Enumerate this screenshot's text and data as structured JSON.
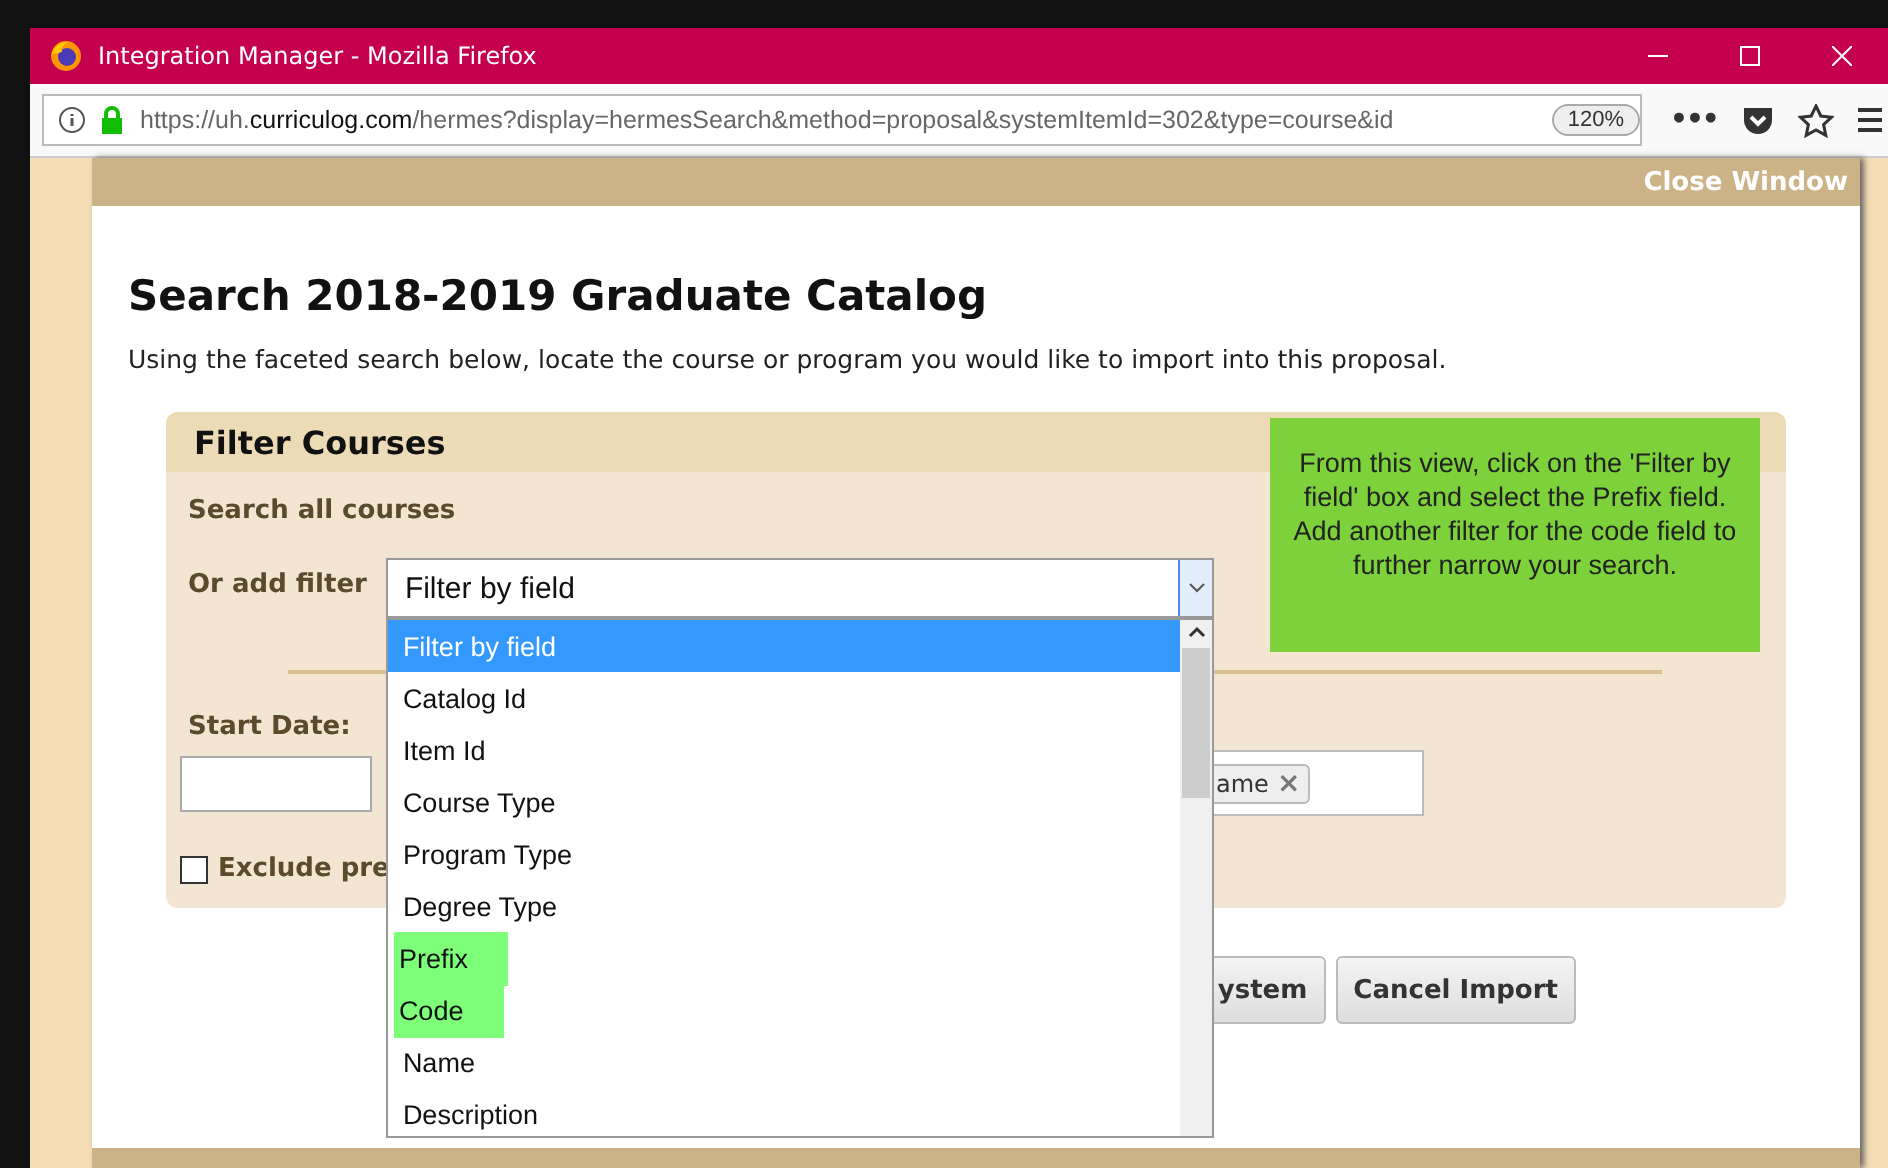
{
  "window": {
    "title": "Integration Manager - Mozilla Firefox"
  },
  "address_bar": {
    "url_prefix": "https://uh.",
    "url_domain": "curriculog.com",
    "url_rest": "/hermes?display=hermesSearch&method=proposal&systemItemId=302&type=course&id",
    "zoom": "120%",
    "more": "•••"
  },
  "modal": {
    "close_label": "Close Window",
    "title": "Search 2018-2019 Graduate Catalog",
    "description": "Using the faceted search below, locate the course or program you would like to import into this proposal.",
    "panel": {
      "title": "Filter Courses",
      "search_label": "Search all courses",
      "filter_label": "Or add filter",
      "filter_value": "Filter by field",
      "start_date_label": "Start Date:",
      "chip_text": "ame",
      "chip_remove": "×",
      "exclude_label": "Exclude pre",
      "exclude_checked": false
    },
    "dropdown_options": [
      {
        "label": "Filter by field",
        "selected": true,
        "highlighted": false
      },
      {
        "label": "Catalog Id",
        "selected": false,
        "highlighted": false
      },
      {
        "label": "Item Id",
        "selected": false,
        "highlighted": false
      },
      {
        "label": "Course Type",
        "selected": false,
        "highlighted": false
      },
      {
        "label": "Program Type",
        "selected": false,
        "highlighted": false
      },
      {
        "label": "Degree Type",
        "selected": false,
        "highlighted": false
      },
      {
        "label": "Prefix",
        "selected": false,
        "highlighted": true
      },
      {
        "label": "Code",
        "selected": false,
        "highlighted": true
      },
      {
        "label": "Name",
        "selected": false,
        "highlighted": false
      },
      {
        "label": "Description",
        "selected": false,
        "highlighted": false
      }
    ],
    "buttons": [
      "ystem",
      "Cancel Import"
    ],
    "callout": "From this view, click on the 'Filter by field' box and select the Prefix field. Add another filter for the code field to further narrow your search."
  }
}
